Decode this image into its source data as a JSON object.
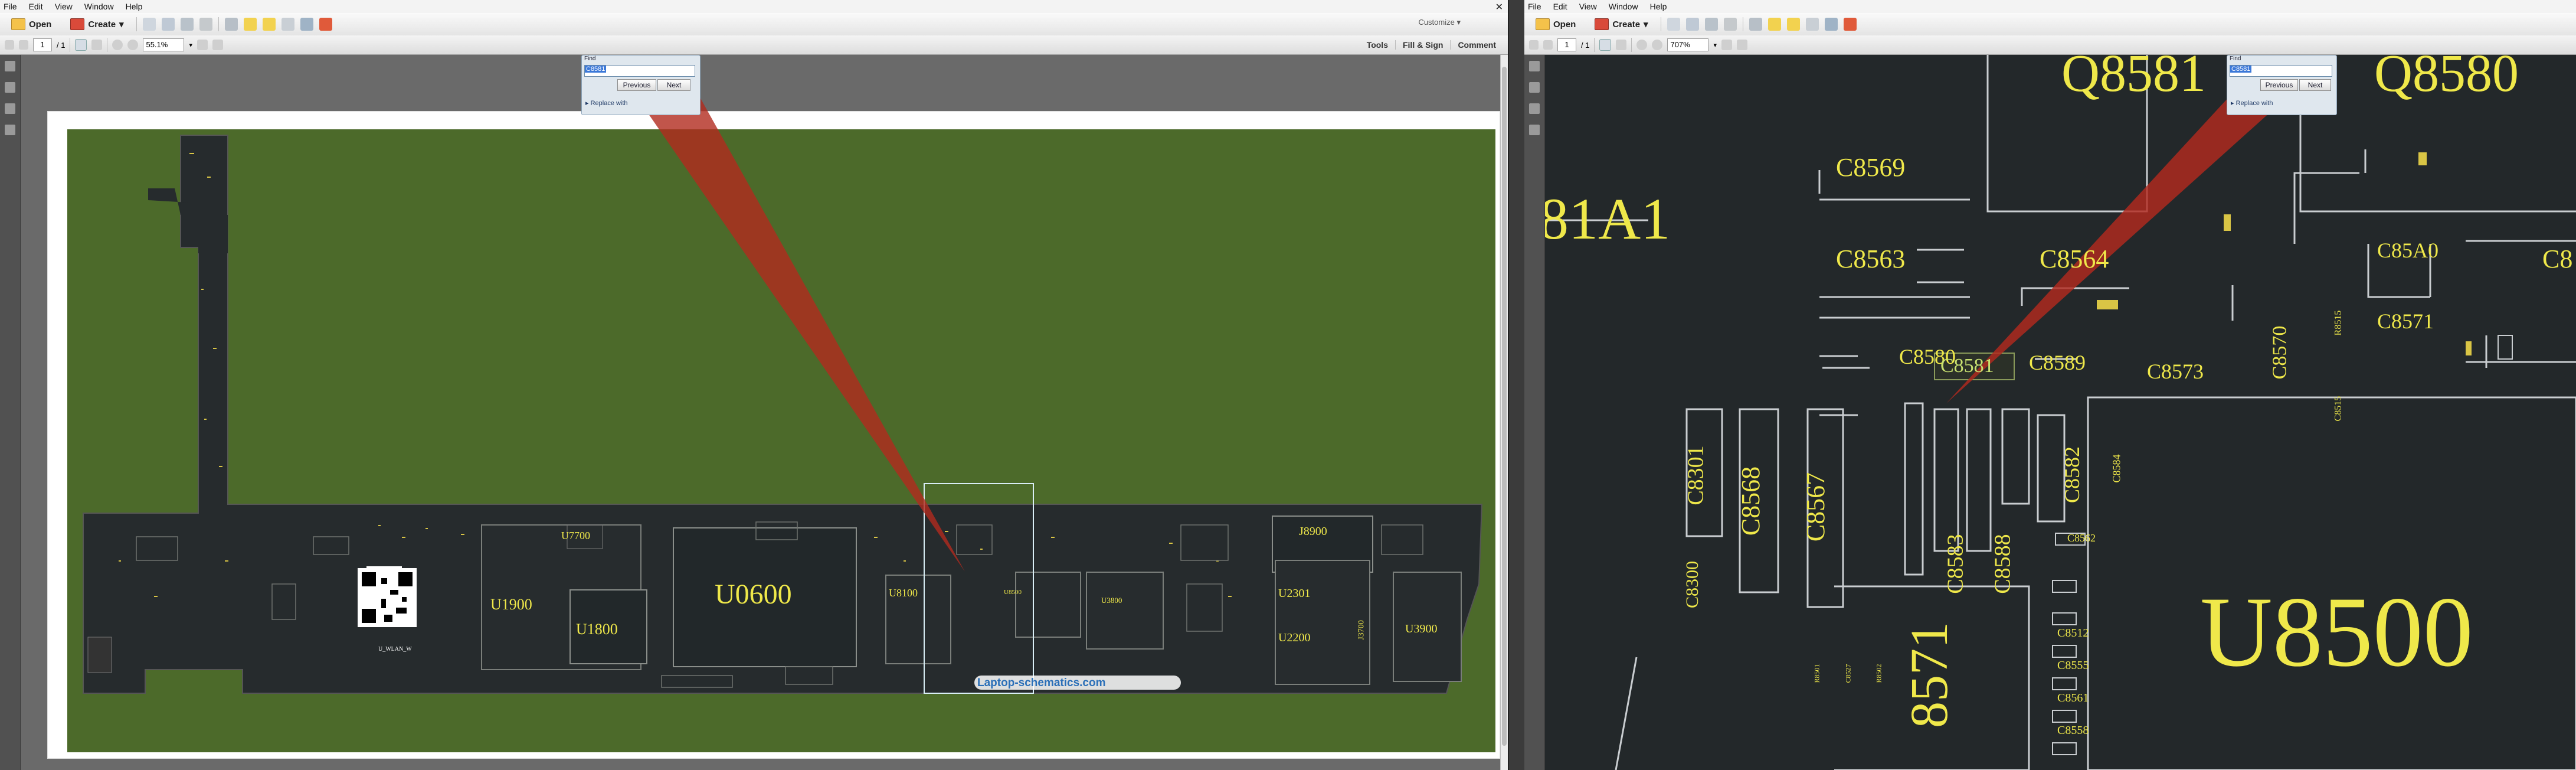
{
  "menu": [
    "File",
    "Edit",
    "View",
    "Window",
    "Help"
  ],
  "toolbar": {
    "open_label": "Open",
    "create_label": "Create",
    "customize_label": "Customize"
  },
  "nav": {
    "page_current": "1",
    "page_total": "1"
  },
  "left_window": {
    "zoom": "55.1%",
    "tools_label": "Tools",
    "fill_sign_label": "Fill & Sign",
    "comment_label": "Comment",
    "components": {
      "u0600": "U0600",
      "u1900": "U1900",
      "u1800": "U1800",
      "u7700": "U7700",
      "u8100": "U8100",
      "u2301": "U2301",
      "u2200": "U2200",
      "u3900": "U3900",
      "u3800": "U3800",
      "j8900": "J8900",
      "u8500": "U8500",
      "j3700": "J3700",
      "u1_wlan": "U_WLAN_W"
    },
    "watermark": "Laptop-schematics.com"
  },
  "right_window": {
    "zoom": "707%",
    "labels": {
      "q8581": "Q8581",
      "q8580": "Q8580",
      "r81a1": "81A1",
      "c8569": "C8569",
      "c8563": "C8563",
      "c8564": "C8564",
      "c85a0": "C85A0",
      "c8_edge": "C8",
      "c8571": "C8571",
      "c8580": "C8580",
      "c8589": "C8589",
      "c8573": "C8573",
      "c8570": "C8570",
      "r8515": "R8515",
      "c8515": "C8515",
      "c8581": "C8581",
      "c8301": "C8301",
      "c8568": "C8568",
      "c8567": "C8567",
      "c8582": "C8582",
      "c8584": "C8584",
      "c8583": "C8583",
      "c8588": "C8588",
      "c8562": "C8562",
      "c8300": "C8300",
      "u8500": "U8500",
      "c8512": "C8512",
      "c8555": "C8555",
      "c8561": "C8561",
      "c8558": "C8558",
      "big8571": "8571",
      "r8501": "R8501",
      "c8527": "C8527",
      "r8502": "R8502"
    }
  },
  "find": {
    "title": "Find",
    "query": "C8581",
    "previous_label": "Previous",
    "next_label": "Next",
    "replace_label": "Replace with"
  }
}
